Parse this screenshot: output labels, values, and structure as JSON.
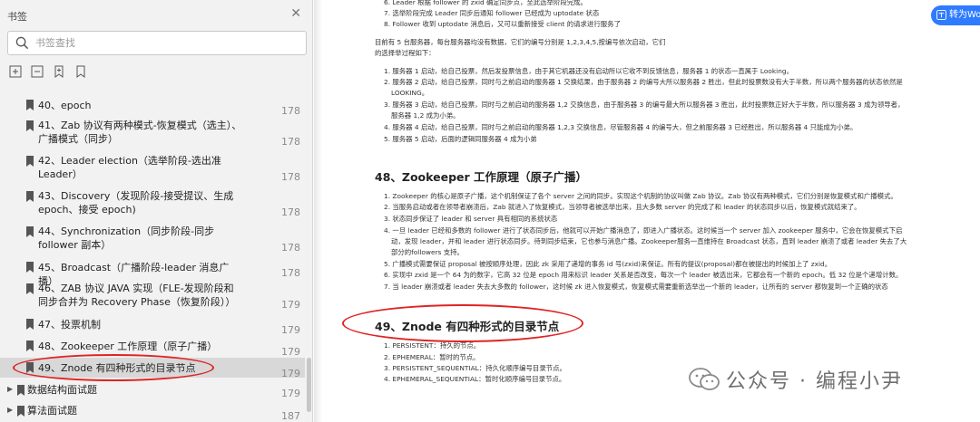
{
  "sidebar": {
    "title": "书签",
    "search_placeholder": "书签查找",
    "items": [
      {
        "label": "40、epoch",
        "page": "178"
      },
      {
        "label": "41、Zab 协议有两种模式-恢复模式（选主）、广播模式（同步）",
        "page": "178"
      },
      {
        "label": "42、Leader election（选举阶段-选出准 Leader）",
        "page": "178"
      },
      {
        "label": "43、Discovery（发现阶段-接受提议、生成 epoch、接受 epoch)",
        "page": "178"
      },
      {
        "label": "44、Synchronization（同步阶段-同步 follower 副本）",
        "page": "178"
      },
      {
        "label": "45、Broadcast（广播阶段-leader 消息广播）",
        "page": "178"
      },
      {
        "label": "46、ZAB 协议 JAVA 实现（FLE-发现阶段和同步合并为 Recovery Phase（恢复阶段））",
        "page": "179"
      },
      {
        "label": "47、投票机制",
        "page": "179"
      },
      {
        "label": "48、Zookeeper 工作原理（原子广播）",
        "page": "179"
      },
      {
        "label": "49、Znode 有四种形式的目录节点",
        "page": "179"
      }
    ],
    "folders": [
      {
        "label": "数据结构面试题",
        "page": "179"
      },
      {
        "label": "算法面试题",
        "page": "187"
      }
    ]
  },
  "translate_label": "转为Wo",
  "doc": {
    "top_lines": [
      "6. Leader 根据 follower 的 zxid 确定同步点，至此选举阶段完成。",
      "7. 选举阶段完成 Leader 同步后通知 follower 已经成为 uptodate 状态",
      "8. Follower 收到 uptodate 消息后，又可以重新接受 client 的请求进行服务了"
    ],
    "intro_lines": [
      "目前有 5 台服务器，每台服务器均没有数据，它们的编号分别是 1,2,3,4,5,按编号依次启动，它们",
      "的选择举过程如下："
    ],
    "vote_lines": [
      "1. 服务器 1 启动，给自己投票，然后发投票信息，由于其它机器还没有启动所以它收不到反馈信息，服务器 1 的状态一直属于 Looking。",
      "2. 服务器 2 启动，给自己投票，同时与之前启动的服务器 1 交换结果，由于服务器 2 的编号大所以服务器 2 胜出，但此时投票数没有大于半数，所以两个服务器的状态依然是",
      "LOOKING。",
      "3. 服务器 3 启动，给自己投票，同时与之前启动的服务器 1,2 交换信息，由于服务器 3 的编号最大所以服务器 3 胜出，此时投票数正好大于半数，所以服务器 3 成为领导者，",
      "服务器 1,2 成为小弟。",
      "4. 服务器 4 启动，给自己投票，同时与之前启动的服务器 1,2,3 交换信息，尽管服务器 4 的编号大，但之前服务器 3 已经胜出，所以服务器 4 只能成为小弟。",
      "5. 服务器 5 启动，后面的逻辑同服务器 4 成为小弟"
    ],
    "h48": "48、Zookeeper 工作原理（原子广播）",
    "p48_lines": [
      "1. Zookeeper 的核心是原子广播，这个机制保证了各个 server 之间的同步。实现这个机制的协议叫做 Zab 协议。Zab 协议有两种模式，它们分别是恢复模式和广播模式。",
      "2. 当服务启动或者在领导者崩溃后，Zab 就进入了恢复模式，当领导者被选举出来，且大多数 server 的完成了和 leader 的状态同步以后，恢复模式就结束了。",
      "3. 状态同步保证了 leader 和 server 具有相同的系统状态",
      "4. 一旦 leader 已经和多数的 follower 进行了状态同步后，他就可以开始广播消息了，即进入广播状态。这时候当一个 server 加入 zookeeper 服务中，它会在恢复模式下启",
      "动，发现 leader，并和 leader 进行状态同步。待到同步结束，它也参与消息广播。Zookeeper服务一直维持在 Broadcast 状态，直到 leader 崩溃了或者 leader 失去了大",
      "部分的followers 支持。",
      "5. 广播模式需要保证 proposal 被按顺序处理，因此 zk 采用了递增的事务 id 号(zxid)来保证。所有的提议(proposal)都在被提出的时候加上了 zxid。",
      "6. 实现中 zxid 是一个 64 为的数字，它高 32 位是 epoch 用来标识 leader 关系是否改变，每次一个 leader 被选出来，它都会有一个新的 epoch。低 32 位是个递增计数。",
      "7. 当 leader 崩溃或者 leader 失去大多数的 follower，这时候 zk 进入恢复模式，恢复模式需要重新选举出一个新的 leader，让所有的 server 都恢复到一个正确的状态"
    ],
    "h49": "49、Znode 有四种形式的目录节点",
    "p49_lines": [
      "1. PERSISTENT：持久的节点。",
      "2. EPHEMERAL：暂时的节点。",
      "3. PERSISTENT_SEQUENTIAL：持久化顺序编号目录节点。",
      "4. EPHEMERAL_SEQUENTIAL：暂时化顺序编号目录节点。"
    ]
  },
  "watermark": "公众号 · 编程小尹",
  "colors": {
    "accent": "#2f7bff",
    "highlight_ellipse": "#e02424"
  }
}
